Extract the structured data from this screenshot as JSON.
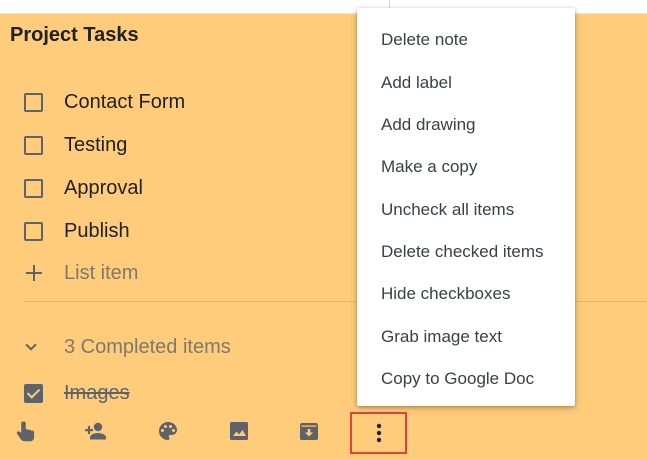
{
  "note": {
    "title": "Project Tasks",
    "items": [
      {
        "label": "Contact Form",
        "checked": false
      },
      {
        "label": "Testing",
        "checked": false
      },
      {
        "label": "Approval",
        "checked": false
      },
      {
        "label": "Publish",
        "checked": false
      }
    ],
    "add_item_placeholder": "List item",
    "completed_summary": "3 Completed items",
    "completed_items": [
      {
        "label": "Images",
        "checked": true
      }
    ],
    "background_color": "#fecc7a"
  },
  "menu": {
    "items": [
      "Delete note",
      "Add label",
      "Add drawing",
      "Make a copy",
      "Uncheck all items",
      "Delete checked items",
      "Hide checkboxes",
      "Grab image text",
      "Copy to Google Doc"
    ]
  },
  "toolbar": {
    "icons": [
      "remind-me-icon",
      "collaborator-icon",
      "color-palette-icon",
      "add-image-icon",
      "archive-icon",
      "more-options-icon"
    ],
    "highlight_color": "#e3413a"
  }
}
